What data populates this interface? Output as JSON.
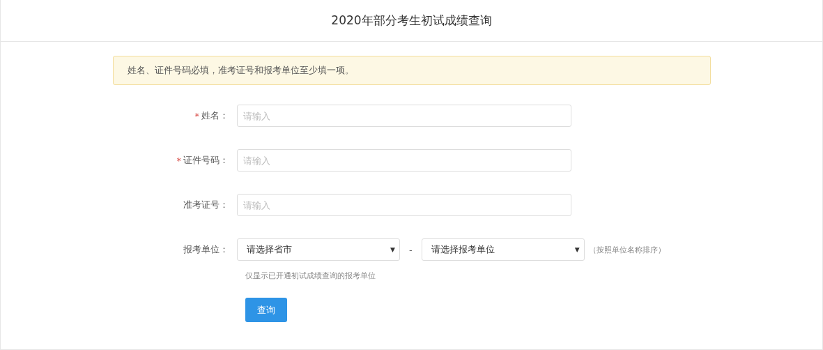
{
  "header": {
    "title": "2020年部分考生初试成绩查询"
  },
  "notice": "姓名、证件号码必填，准考证号和报考单位至少填一项。",
  "required_mark": "*",
  "fields": [
    {
      "label": "姓名：",
      "required": true,
      "placeholder": "请输入"
    },
    {
      "label": "证件号码：",
      "required": true,
      "placeholder": "请输入"
    },
    {
      "label": "准考证号：",
      "required": false,
      "placeholder": "请输入"
    }
  ],
  "unit": {
    "label": "报考单位：",
    "selects": [
      {
        "value": "请选择省市",
        "caret": "▼"
      },
      {
        "value": "请选择报考单位",
        "caret": "▼"
      }
    ],
    "separator": "-",
    "sort_note": "（按照单位名称排序）",
    "hint": "仅显示已开通初试成绩查询的报考单位"
  },
  "button": "查询"
}
